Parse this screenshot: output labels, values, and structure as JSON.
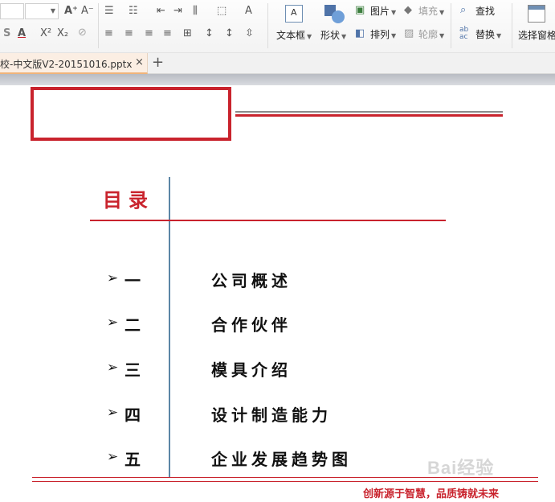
{
  "ribbon": {
    "font_group": {
      "grow_font": "A⁺",
      "shrink_font": "A⁻",
      "strike": "S",
      "font_color": "A",
      "superscript": "X²",
      "subscript": "X₂"
    },
    "insert_group": {
      "textbox_label": "文本框",
      "shape_label": "形状",
      "picture_label": "图片",
      "fill_label": "填充",
      "arrange_label": "排列",
      "outline_label": "轮廓",
      "find_label": "查找",
      "replace_label": "替换",
      "select_pane_label": "选择窗格"
    }
  },
  "tabs": {
    "doc_tab_label": "校-中文版V2-20151016.pptx",
    "close_glyph": "×",
    "new_tab_glyph": "+"
  },
  "slide": {
    "toc_heading": "目录",
    "toc_items": [
      {
        "arrow": "➢",
        "num": "一",
        "text": "公司概述"
      },
      {
        "arrow": "➢",
        "num": "二",
        "text": "合作伙伴"
      },
      {
        "arrow": "➢",
        "num": "三",
        "text": "模具介绍"
      },
      {
        "arrow": "➢",
        "num": "四",
        "text": "设计制造能力"
      },
      {
        "arrow": "➢",
        "num": "五",
        "text": "企业发展趋势图"
      }
    ],
    "footer_slogan": "创新源于智慧，品质铸就未来",
    "watermark": "Bai经验",
    "colors": {
      "accent_red": "#c9232d",
      "divider_blue": "#5b86a6"
    }
  }
}
